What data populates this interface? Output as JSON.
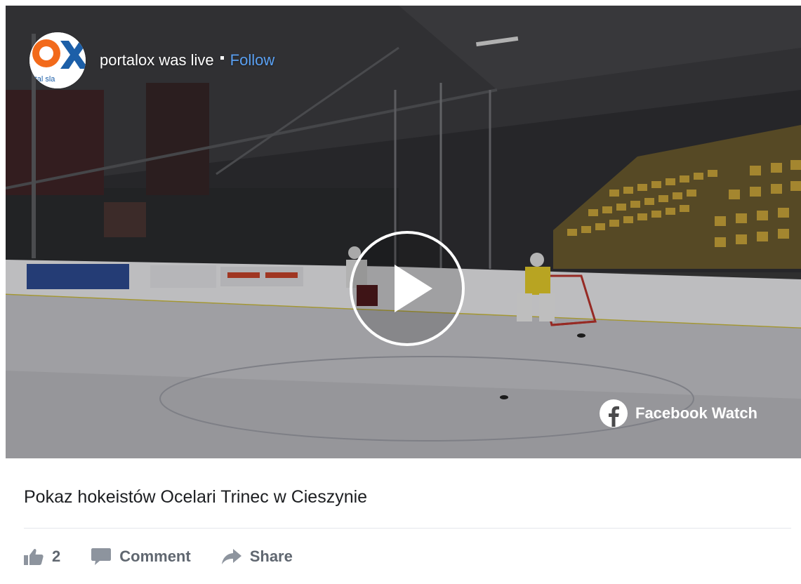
{
  "video": {
    "page_name": "portalox",
    "status_text": "portalox was live",
    "follow_label": "Follow",
    "avatar_text_main": "OX",
    "avatar_text_sub": "rtal sla",
    "play_icon": "play-icon",
    "watch_label": "Facebook Watch",
    "colors": {
      "follow": "#5aa0f2",
      "avatar_orange": "#f26a1b",
      "avatar_blue": "#1c5fa8"
    }
  },
  "post": {
    "caption": "Pokaz hokeistów Ocelari Trinec w Cieszynie"
  },
  "actions": {
    "like_count": "2",
    "comment_label": "Comment",
    "share_label": "Share",
    "like_icon": "thumbs-up-icon",
    "comment_icon": "comment-bubble-icon",
    "share_icon": "share-arrow-icon"
  }
}
